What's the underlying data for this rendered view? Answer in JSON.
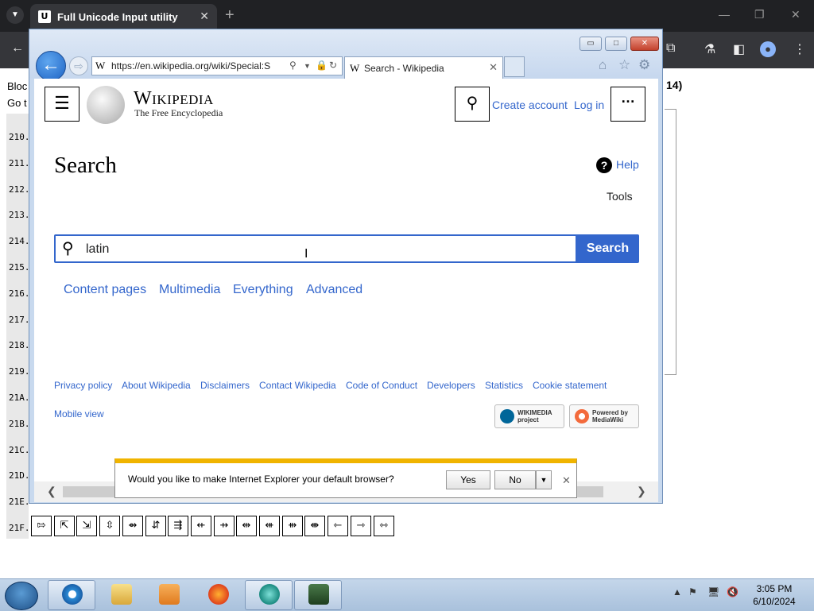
{
  "chrome": {
    "tab_title": "Full Unicode Input utility",
    "tab_favicon": "U"
  },
  "background_page": {
    "block_label": "Bloc",
    "goto_label": "Go t",
    "header_suffix": "14)",
    "row_labels": [
      "210.",
      "211.",
      "212.",
      "213.",
      "214.",
      "215.",
      "216.",
      "217.",
      "218.",
      "219.",
      "21A.",
      "21B.",
      "21C.",
      "21D.",
      "21E.",
      "21F."
    ],
    "last_row_chars": [
      "⇰",
      "⇱",
      "⇲",
      "⇳",
      "⇴",
      "⇵",
      "⇶",
      "⇷",
      "⇸",
      "⇹",
      "⇺",
      "⇻",
      "⇼",
      "⇽",
      "⇾",
      "⇿"
    ]
  },
  "ie": {
    "address_url": "https://en.wikipedia.org/wiki/Special:Sear",
    "tab_title": "Search - Wikipedia"
  },
  "wiki": {
    "wordmark": "Wikipedia",
    "tagline": "The Free Encyclopedia",
    "create_account": "Create account",
    "log_in": "Log in",
    "heading": "Search",
    "help": "Help",
    "tools": "Tools",
    "search_value": "latin ",
    "search_button": "Search",
    "filters": [
      "Content pages",
      "Multimedia",
      "Everything",
      "Advanced"
    ],
    "footer_links": [
      "Privacy policy",
      "About Wikipedia",
      "Disclaimers",
      "Contact Wikipedia",
      "Code of Conduct",
      "Developers",
      "Statistics",
      "Cookie statement"
    ],
    "mobile_view": "Mobile view",
    "badge_wikimedia": [
      "WIKIMEDIA",
      "project"
    ],
    "badge_mediawiki": [
      "Powered by",
      "MediaWiki"
    ]
  },
  "notification": {
    "message": "Would you like to make Internet Explorer your default browser?",
    "yes": "Yes",
    "no": "No"
  },
  "taskbar": {
    "time": "3:05 PM",
    "date": "6/10/2024"
  }
}
